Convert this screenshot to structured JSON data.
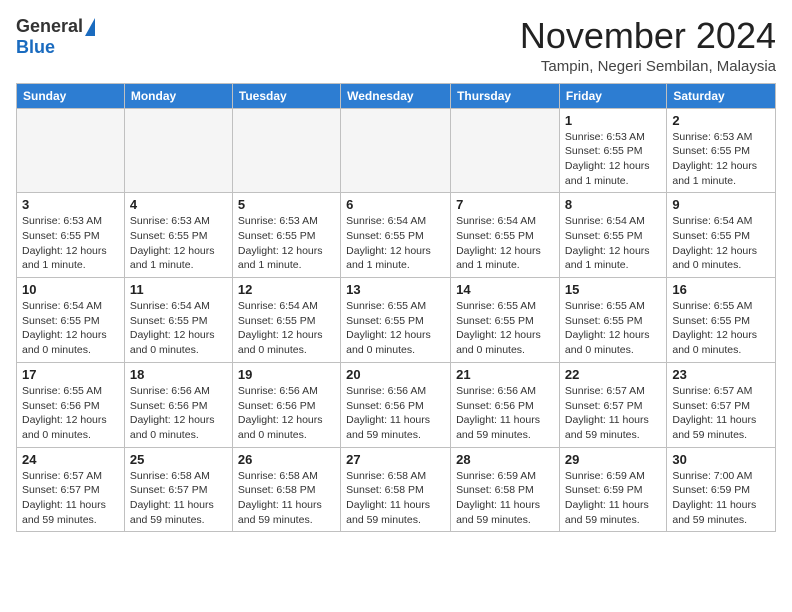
{
  "logo": {
    "general": "General",
    "blue": "Blue"
  },
  "header": {
    "month": "November 2024",
    "location": "Tampin, Negeri Sembilan, Malaysia"
  },
  "weekdays": [
    "Sunday",
    "Monday",
    "Tuesday",
    "Wednesday",
    "Thursday",
    "Friday",
    "Saturday"
  ],
  "weeks": [
    [
      {
        "day": "",
        "info": ""
      },
      {
        "day": "",
        "info": ""
      },
      {
        "day": "",
        "info": ""
      },
      {
        "day": "",
        "info": ""
      },
      {
        "day": "",
        "info": ""
      },
      {
        "day": "1",
        "info": "Sunrise: 6:53 AM\nSunset: 6:55 PM\nDaylight: 12 hours and 1 minute."
      },
      {
        "day": "2",
        "info": "Sunrise: 6:53 AM\nSunset: 6:55 PM\nDaylight: 12 hours and 1 minute."
      }
    ],
    [
      {
        "day": "3",
        "info": "Sunrise: 6:53 AM\nSunset: 6:55 PM\nDaylight: 12 hours and 1 minute."
      },
      {
        "day": "4",
        "info": "Sunrise: 6:53 AM\nSunset: 6:55 PM\nDaylight: 12 hours and 1 minute."
      },
      {
        "day": "5",
        "info": "Sunrise: 6:53 AM\nSunset: 6:55 PM\nDaylight: 12 hours and 1 minute."
      },
      {
        "day": "6",
        "info": "Sunrise: 6:54 AM\nSunset: 6:55 PM\nDaylight: 12 hours and 1 minute."
      },
      {
        "day": "7",
        "info": "Sunrise: 6:54 AM\nSunset: 6:55 PM\nDaylight: 12 hours and 1 minute."
      },
      {
        "day": "8",
        "info": "Sunrise: 6:54 AM\nSunset: 6:55 PM\nDaylight: 12 hours and 1 minute."
      },
      {
        "day": "9",
        "info": "Sunrise: 6:54 AM\nSunset: 6:55 PM\nDaylight: 12 hours and 0 minutes."
      }
    ],
    [
      {
        "day": "10",
        "info": "Sunrise: 6:54 AM\nSunset: 6:55 PM\nDaylight: 12 hours and 0 minutes."
      },
      {
        "day": "11",
        "info": "Sunrise: 6:54 AM\nSunset: 6:55 PM\nDaylight: 12 hours and 0 minutes."
      },
      {
        "day": "12",
        "info": "Sunrise: 6:54 AM\nSunset: 6:55 PM\nDaylight: 12 hours and 0 minutes."
      },
      {
        "day": "13",
        "info": "Sunrise: 6:55 AM\nSunset: 6:55 PM\nDaylight: 12 hours and 0 minutes."
      },
      {
        "day": "14",
        "info": "Sunrise: 6:55 AM\nSunset: 6:55 PM\nDaylight: 12 hours and 0 minutes."
      },
      {
        "day": "15",
        "info": "Sunrise: 6:55 AM\nSunset: 6:55 PM\nDaylight: 12 hours and 0 minutes."
      },
      {
        "day": "16",
        "info": "Sunrise: 6:55 AM\nSunset: 6:55 PM\nDaylight: 12 hours and 0 minutes."
      }
    ],
    [
      {
        "day": "17",
        "info": "Sunrise: 6:55 AM\nSunset: 6:56 PM\nDaylight: 12 hours and 0 minutes."
      },
      {
        "day": "18",
        "info": "Sunrise: 6:56 AM\nSunset: 6:56 PM\nDaylight: 12 hours and 0 minutes."
      },
      {
        "day": "19",
        "info": "Sunrise: 6:56 AM\nSunset: 6:56 PM\nDaylight: 12 hours and 0 minutes."
      },
      {
        "day": "20",
        "info": "Sunrise: 6:56 AM\nSunset: 6:56 PM\nDaylight: 11 hours and 59 minutes."
      },
      {
        "day": "21",
        "info": "Sunrise: 6:56 AM\nSunset: 6:56 PM\nDaylight: 11 hours and 59 minutes."
      },
      {
        "day": "22",
        "info": "Sunrise: 6:57 AM\nSunset: 6:57 PM\nDaylight: 11 hours and 59 minutes."
      },
      {
        "day": "23",
        "info": "Sunrise: 6:57 AM\nSunset: 6:57 PM\nDaylight: 11 hours and 59 minutes."
      }
    ],
    [
      {
        "day": "24",
        "info": "Sunrise: 6:57 AM\nSunset: 6:57 PM\nDaylight: 11 hours and 59 minutes."
      },
      {
        "day": "25",
        "info": "Sunrise: 6:58 AM\nSunset: 6:57 PM\nDaylight: 11 hours and 59 minutes."
      },
      {
        "day": "26",
        "info": "Sunrise: 6:58 AM\nSunset: 6:58 PM\nDaylight: 11 hours and 59 minutes."
      },
      {
        "day": "27",
        "info": "Sunrise: 6:58 AM\nSunset: 6:58 PM\nDaylight: 11 hours and 59 minutes."
      },
      {
        "day": "28",
        "info": "Sunrise: 6:59 AM\nSunset: 6:58 PM\nDaylight: 11 hours and 59 minutes."
      },
      {
        "day": "29",
        "info": "Sunrise: 6:59 AM\nSunset: 6:59 PM\nDaylight: 11 hours and 59 minutes."
      },
      {
        "day": "30",
        "info": "Sunrise: 7:00 AM\nSunset: 6:59 PM\nDaylight: 11 hours and 59 minutes."
      }
    ]
  ]
}
